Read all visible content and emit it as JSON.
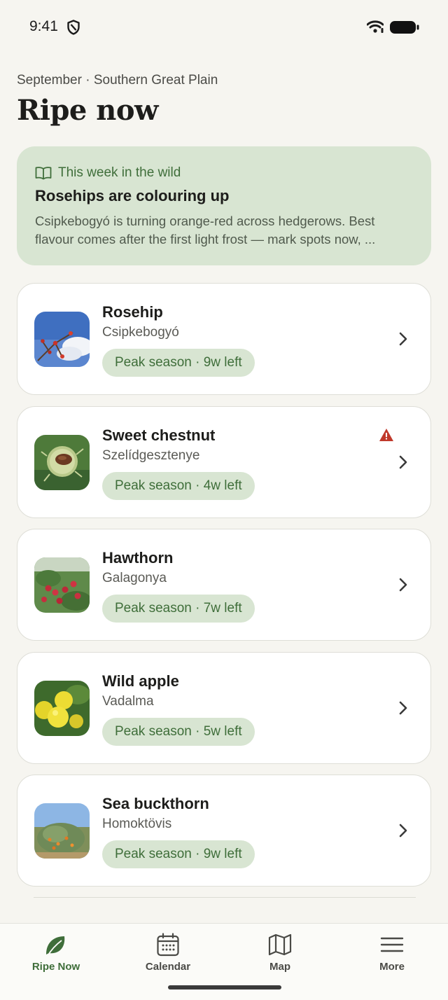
{
  "status": {
    "time": "9:41"
  },
  "header": {
    "subtitle": "September · Southern Great Plain",
    "title": "Ripe now"
  },
  "highlight": {
    "label": "This week in the wild",
    "title": "Rosehips are colouring up",
    "body": "Csipkebogyó is turning orange-red across hedgerows. Best flavour comes after the first light frost — mark spots now, ..."
  },
  "items": [
    {
      "name": "Rosehip",
      "local": "Csipkebogyó",
      "badge": "Peak season · 9w left",
      "icon": "rosehip-photo",
      "warning": false
    },
    {
      "name": "Sweet chestnut",
      "local": "Szelídgesztenye",
      "badge": "Peak season · 4w left",
      "icon": "chestnut-photo",
      "warning": true
    },
    {
      "name": "Hawthorn",
      "local": "Galagonya",
      "badge": "Peak season · 7w left",
      "icon": "hawthorn-photo",
      "warning": false
    },
    {
      "name": "Wild apple",
      "local": "Vadalma",
      "badge": "Peak season · 5w left",
      "icon": "wild-apple-photo",
      "warning": false
    },
    {
      "name": "Sea buckthorn",
      "local": "Homoktövis",
      "badge": "Peak season · 9w left",
      "icon": "sea-buckthorn-photo",
      "warning": false
    }
  ],
  "nav": [
    {
      "label": "Ripe Now",
      "icon": "leaf-icon",
      "active": true
    },
    {
      "label": "Calendar",
      "icon": "calendar-icon",
      "active": false
    },
    {
      "label": "Map",
      "icon": "map-icon",
      "active": false
    },
    {
      "label": "More",
      "icon": "menu-icon",
      "active": false
    }
  ],
  "colors": {
    "background": "#f6f5f0",
    "accent": "#3f6e3a",
    "pill": "#d8e5d2",
    "warning": "#c0392b"
  }
}
